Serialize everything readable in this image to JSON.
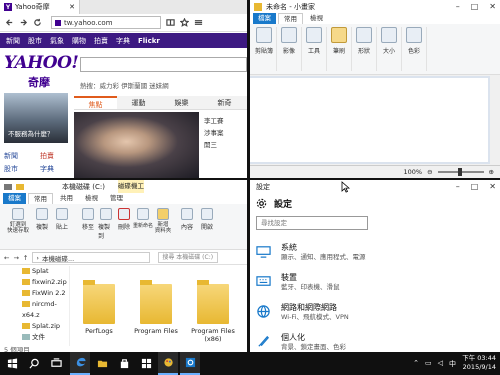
{
  "browser": {
    "tab_title": "Yahoo奇摩",
    "url": "tw.yahoo.com",
    "nav_items": [
      "新聞",
      "股市",
      "氣象",
      "購物",
      "拍賣",
      "字典",
      "Flickr"
    ],
    "logo_text": "YAHOO!",
    "logo_sub": "奇摩",
    "hot_label": "熱搜：",
    "hot_terms": "威力彩   伊斯蘭國   迷妹網",
    "tabs": [
      "焦點",
      "運動",
      "娛樂",
      "新奇"
    ],
    "thumb_caption": "不服務為什麼？",
    "links_col1": [
      "新聞",
      "股市",
      "氣象"
    ],
    "links_col2": [
      "拍賣",
      "字典",
      "電影"
    ],
    "news_items": [
      "李工賽",
      "涉事案",
      "開三"
    ]
  },
  "paint": {
    "title": "未命名 - 小畫家",
    "tabs": [
      "檔案",
      "常用",
      "檢視"
    ],
    "groups": [
      "剪貼簿",
      "影像",
      "工具",
      "筆刷",
      "形狀",
      "大小",
      "色彩"
    ],
    "zoom": "100%"
  },
  "explorer": {
    "title": "本機磁碟 (C:)",
    "manage_label": "磁碟機工具",
    "tabs": [
      "檔案",
      "常用",
      "共用",
      "檢視",
      "管理"
    ],
    "ribbon_buttons": [
      "釘選到\n快速存取",
      "複製",
      "貼上",
      "移至",
      "複製到",
      "刪除",
      "重新命名",
      "新增\n資料夾",
      "內容",
      "開啟"
    ],
    "path": "本機磁碟...",
    "search_placeholder": "搜尋 本機磁碟 (C:)",
    "tree": [
      "Splat",
      "fixwin2.zip",
      "FixWin 2.2",
      "nircmd-x64.z",
      "Splat.zip",
      "文件"
    ],
    "folders": [
      "PerfLogs",
      "Program Files",
      "Program Files (x86)"
    ],
    "status": "5 個項目"
  },
  "settings": {
    "title": "設定",
    "heading": "設定",
    "search_placeholder": "尋找設定",
    "items": [
      {
        "title": "系統",
        "desc": "顯示、通知、應用程式、電源"
      },
      {
        "title": "裝置",
        "desc": "藍牙、印表機、滑鼠"
      },
      {
        "title": "網路和網際網路",
        "desc": "Wi-Fi、飛航模式、VPN"
      },
      {
        "title": "個人化",
        "desc": "背景、鎖定畫面、色彩"
      }
    ]
  },
  "taskbar": {
    "time": "下午 03:44",
    "date": "2015/9/14",
    "ime": "中"
  }
}
